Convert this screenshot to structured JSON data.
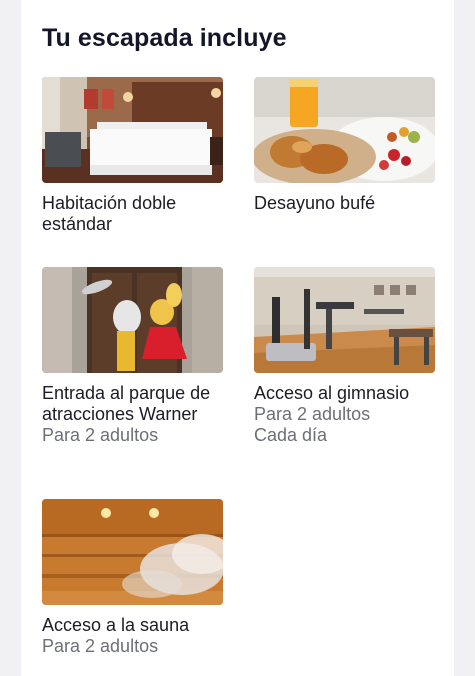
{
  "section": {
    "title": "Tu escapada incluye"
  },
  "items": [
    {
      "image": "hotel-room-photo",
      "name": "Habitación doble estándar",
      "details": []
    },
    {
      "image": "breakfast-buffet-photo",
      "name": "Desayuno bufé",
      "details": []
    },
    {
      "image": "warner-park-characters-photo",
      "name": "Entrada al parque de atracciones Warner",
      "details": [
        "Para 2 adultos"
      ]
    },
    {
      "image": "gym-photo",
      "name": "Acceso al gimnasio",
      "details": [
        "Para 2 adultos",
        "Cada día"
      ]
    },
    {
      "image": "sauna-photo",
      "name": "Acceso a la sauna",
      "details": [
        "Para 2 adultos"
      ]
    }
  ]
}
